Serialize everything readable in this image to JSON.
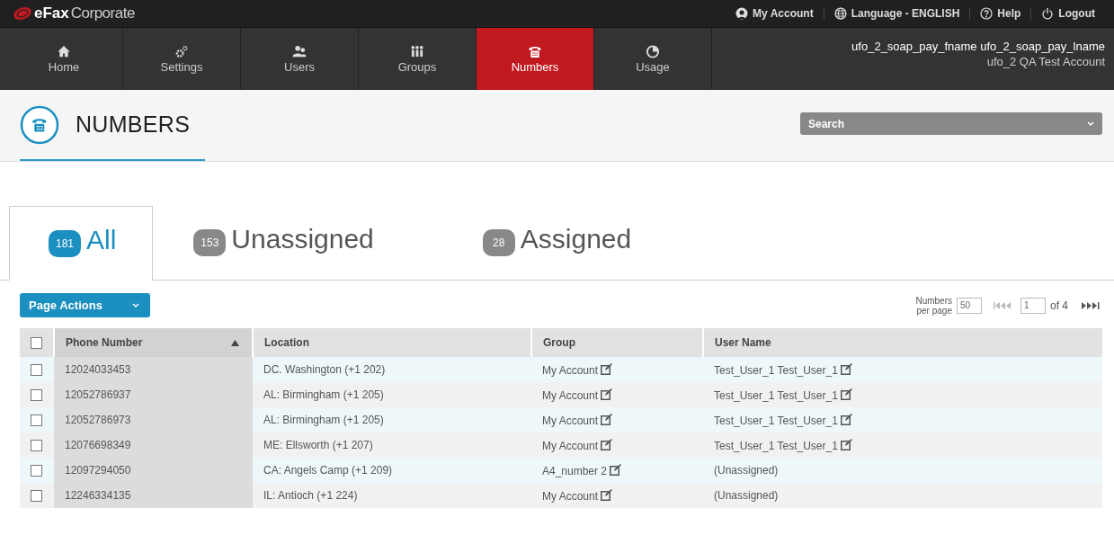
{
  "top_bar": {
    "logo_bold": "eFax",
    "logo_light": "Corporate",
    "links": [
      {
        "kind": "account",
        "label": "My Account"
      },
      {
        "kind": "language",
        "label": "Language - ENGLISH"
      },
      {
        "kind": "help",
        "label": "Help"
      },
      {
        "kind": "logout",
        "label": "Logout"
      }
    ]
  },
  "nav": {
    "items": [
      {
        "kind": "home",
        "label": "Home",
        "selected": false
      },
      {
        "kind": "settings",
        "label": "Settings",
        "selected": false
      },
      {
        "kind": "users",
        "label": "Users",
        "selected": false
      },
      {
        "kind": "groups",
        "label": "Groups",
        "selected": false
      },
      {
        "kind": "numbers",
        "label": "Numbers",
        "selected": true
      },
      {
        "kind": "usage",
        "label": "Usage",
        "selected": false
      }
    ],
    "user_name": "ufo_2_soap_pay_fname ufo_2_soap_pay_lname",
    "account_name": "ufo_2 QA Test Account"
  },
  "page_header": {
    "title": "NUMBERS",
    "search": {
      "placeholder": "Search"
    }
  },
  "tabs": [
    {
      "count": "181",
      "label": "All",
      "selected": true
    },
    {
      "count": "153",
      "label": "Unassigned",
      "selected": false
    },
    {
      "count": "28",
      "label": "Assigned",
      "selected": false
    }
  ],
  "toolbar": {
    "page_actions": "Page Actions",
    "per_page_label": [
      "Numbers",
      "per page"
    ],
    "per_page": "50",
    "page": "1",
    "page_of": "of 4"
  },
  "table": {
    "select_all_checked": false,
    "columns": [
      {
        "label": "Phone Number",
        "sorted": true
      },
      {
        "label": "Location",
        "sorted": false
      },
      {
        "label": "Group",
        "sorted": false
      },
      {
        "label": "User Name",
        "sorted": false
      }
    ],
    "rows": [
      {
        "checked": false,
        "phone": "12024033453",
        "location": "DC. Washington (+1 202)",
        "group": {
          "text": "My Account",
          "editable": true
        },
        "user": {
          "text": "Test_User_1 Test_User_1",
          "editable": true
        }
      },
      {
        "checked": false,
        "phone": "12052786937",
        "location": "AL: Birmingham (+1 205)",
        "group": {
          "text": "My Account",
          "editable": true
        },
        "user": {
          "text": "Test_User_1 Test_User_1",
          "editable": true
        }
      },
      {
        "checked": false,
        "phone": "12052786973",
        "location": "AL: Birmingham (+1 205)",
        "group": {
          "text": "My Account",
          "editable": true
        },
        "user": {
          "text": "Test_User_1 Test_User_1",
          "editable": true
        }
      },
      {
        "checked": false,
        "phone": "12076698349",
        "location": "ME: Ellsworth (+1 207)",
        "group": {
          "text": "My Account",
          "editable": true
        },
        "user": {
          "text": "Test_User_1 Test_User_1",
          "editable": true
        }
      },
      {
        "checked": false,
        "phone": "12097294050",
        "location": "CA: Angels Camp (+1 209)",
        "group": {
          "text": "A4_number 2",
          "editable": true
        },
        "user": {
          "text": "(Unassigned)",
          "editable": false
        }
      },
      {
        "checked": false,
        "phone": "12246334135",
        "location": "IL: Antioch (+1 224)",
        "group": {
          "text": "My Account",
          "editable": true
        },
        "user": {
          "text": "(Unassigned)",
          "editable": false
        }
      }
    ]
  }
}
